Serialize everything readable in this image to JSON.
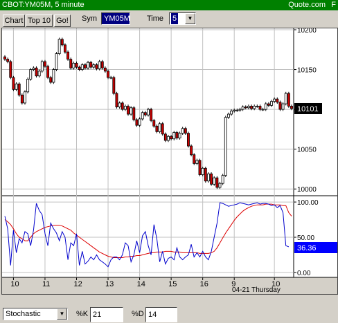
{
  "window": {
    "title": "CBOT:YM05M, 5 minute",
    "brand": "Quote.com",
    "menu_letter": "F"
  },
  "toolbar": {
    "chart_label": "Chart",
    "top10_label": "Top 10",
    "go_label": "Go!",
    "sym_label": "Sym",
    "sym_value": "YM05M",
    "time_label": "Time",
    "time_value": "5"
  },
  "price_panel": {
    "y_ticks": [
      "10200",
      "10150",
      "10100",
      "10050",
      "10000"
    ],
    "current_price": "10101",
    "ylim": [
      9995,
      10200
    ]
  },
  "stoch_panel": {
    "y_ticks": [
      "100.00",
      "50.00",
      "0.00"
    ],
    "current_value": "36.36",
    "ylim": [
      -5,
      105
    ]
  },
  "x_axis": {
    "ticks": [
      "10",
      "11",
      "12",
      "13",
      "14",
      "15",
      "16",
      "9",
      "10"
    ],
    "date_label": "04-21 Thursday"
  },
  "indicator_bar": {
    "indicator_value": "Stochastic",
    "k_label": "%K",
    "k_value": "21",
    "d_label": "%D",
    "d_value": "14"
  },
  "colors": {
    "up_candle": "#ffffff",
    "down_candle": "#cc0000",
    "k_line": "#0000cc",
    "d_line": "#dd0000",
    "price_tag": "#000000",
    "stoch_tag": "#0000ff",
    "titlebar": "#008000"
  },
  "chart_data": [
    {
      "type": "candlestick",
      "title": "",
      "ylim": [
        9995,
        10200
      ],
      "x_ticks": [
        "10",
        "11",
        "12",
        "13",
        "14",
        "15",
        "16",
        "9",
        "10"
      ],
      "close": [
        10163,
        10160,
        10140,
        10125,
        10132,
        10118,
        10108,
        10122,
        10138,
        10150,
        10152,
        10142,
        10148,
        10160,
        10154,
        10140,
        10134,
        10150,
        10170,
        10188,
        10181,
        10172,
        10163,
        10152,
        10158,
        10153,
        10150,
        10156,
        10152,
        10159,
        10153,
        10156,
        10151,
        10160,
        10152,
        10148,
        10140,
        10140,
        10120,
        10103,
        10108,
        10100,
        10104,
        10094,
        10102,
        10087,
        10080,
        10088,
        10096,
        10093,
        10100,
        10086,
        10079,
        10072,
        10082,
        10069,
        10061,
        10066,
        10063,
        10071,
        10064,
        10070,
        10076,
        10070,
        10054,
        10043,
        10032,
        10036,
        10018,
        10026,
        10010,
        10019,
        10006,
        10014,
        10002,
        10007,
        10017,
        10090,
        10094,
        10098,
        10099,
        10099,
        10100,
        10103,
        10102,
        10104,
        10101,
        10104,
        10104,
        10100,
        10100,
        10107,
        10105,
        10110,
        10113,
        10109,
        10100,
        10107,
        10120,
        10104,
        10101
      ],
      "stochastic": {
        "k": [
          80,
          62,
          10,
          60,
          28,
          48,
          42,
          58,
          55,
          38,
          60,
          98,
          88,
          82,
          55,
          38,
          70,
          62,
          56,
          45,
          58,
          50,
          18,
          42,
          38,
          55,
          10,
          30,
          12,
          16,
          22,
          18,
          25,
          18,
          15,
          12,
          8,
          18,
          22,
          22,
          18,
          25,
          42,
          38,
          15,
          25,
          45,
          28,
          52,
          58,
          38,
          25,
          68,
          48,
          15,
          30,
          12,
          20,
          22,
          18,
          35,
          22,
          18,
          22,
          25,
          40,
          22,
          28,
          22,
          30,
          22,
          18,
          30,
          50,
          70,
          99,
          98,
          96,
          94,
          95,
          96,
          97,
          99,
          98,
          97,
          96,
          97,
          98,
          99,
          97,
          98,
          98,
          97,
          95,
          96,
          92,
          95,
          85,
          38,
          36.36
        ],
        "d": [
          75,
          72,
          68,
          62,
          55,
          50,
          48,
          45,
          45,
          50,
          55,
          58,
          60,
          62,
          64,
          65,
          66,
          67,
          67,
          67,
          66,
          64,
          62,
          60,
          56,
          53,
          50,
          47,
          44,
          41,
          38,
          35,
          32,
          29,
          27,
          25,
          23,
          22,
          21,
          21,
          21,
          21,
          22,
          22,
          23,
          23,
          24,
          24,
          25,
          26,
          27,
          28,
          28,
          29,
          29,
          29,
          30,
          30,
          30,
          29,
          29,
          29,
          28,
          28,
          28,
          28,
          28,
          28,
          27,
          27,
          27,
          27,
          28,
          30,
          35,
          42,
          49,
          56,
          62,
          68,
          74,
          79,
          83,
          87,
          90,
          92,
          94,
          95,
          96,
          96,
          96,
          97,
          97,
          97,
          96,
          96,
          96,
          95,
          95,
          85,
          80
        ],
        "ylim": [
          0,
          100
        ]
      }
    }
  ]
}
